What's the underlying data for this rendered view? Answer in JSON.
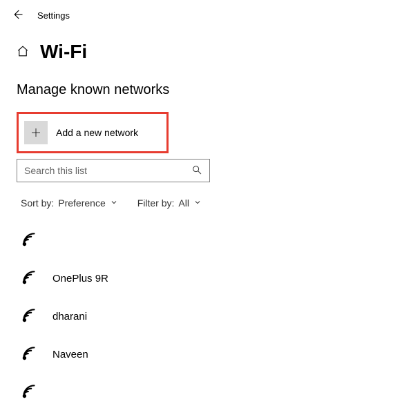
{
  "topbar": {
    "title": "Settings"
  },
  "header": {
    "title": "Wi-Fi"
  },
  "subheading": "Manage known networks",
  "add_network": {
    "label": "Add a new network"
  },
  "search": {
    "placeholder": "Search this list"
  },
  "sort": {
    "label": "Sort by:",
    "value": "Preference"
  },
  "filter": {
    "label": "Filter by:",
    "value": "All"
  },
  "networks": [
    {
      "name": ""
    },
    {
      "name": "OnePlus 9R"
    },
    {
      "name": "dharani"
    },
    {
      "name": "Naveen"
    },
    {
      "name": ""
    }
  ]
}
